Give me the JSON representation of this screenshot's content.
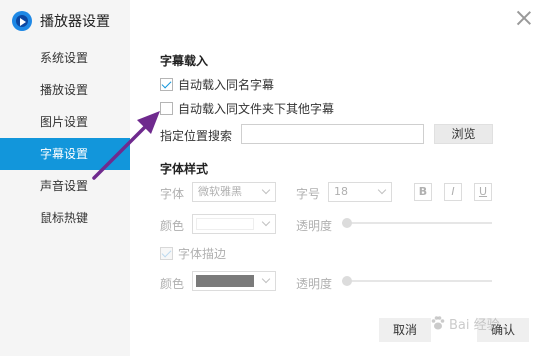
{
  "app": {
    "title": "播放器设置"
  },
  "sidebar": {
    "items": [
      {
        "label": "系统设置",
        "active": false
      },
      {
        "label": "播放设置",
        "active": false
      },
      {
        "label": "图片设置",
        "active": false
      },
      {
        "label": "字幕设置",
        "active": true
      },
      {
        "label": "声音设置",
        "active": false
      },
      {
        "label": "鼠标热键",
        "active": false
      }
    ]
  },
  "subtitle_load": {
    "title": "字幕载入",
    "auto_same_name": {
      "label": "自动载入同名字幕",
      "checked": true
    },
    "auto_same_folder": {
      "label": "自动载入同文件夹下其他字幕",
      "checked": false
    },
    "location_search": {
      "label": "指定位置搜索",
      "value": ""
    },
    "browse_label": "浏览"
  },
  "font_style": {
    "title": "字体样式",
    "font": {
      "label": "字体",
      "value": "微软雅黑"
    },
    "size": {
      "label": "字号",
      "value": "18"
    },
    "bold_label": "B",
    "italic_label": "I",
    "underline_label": "U",
    "color": {
      "label": "颜色",
      "swatch": "#ffffff"
    },
    "opacity": {
      "label": "透明度",
      "value": 0
    },
    "outline": {
      "label": "字体描边",
      "checked": true
    },
    "outline_color": {
      "label": "颜色",
      "swatch": "#7a7a7a"
    },
    "outline_opacity": {
      "label": "透明度",
      "value": 0
    }
  },
  "footer": {
    "cancel_label": "取消",
    "ok_label": "确认"
  },
  "annotation": {
    "color": "#6f2a8e"
  },
  "watermark": {
    "text": "Bai 经验"
  }
}
